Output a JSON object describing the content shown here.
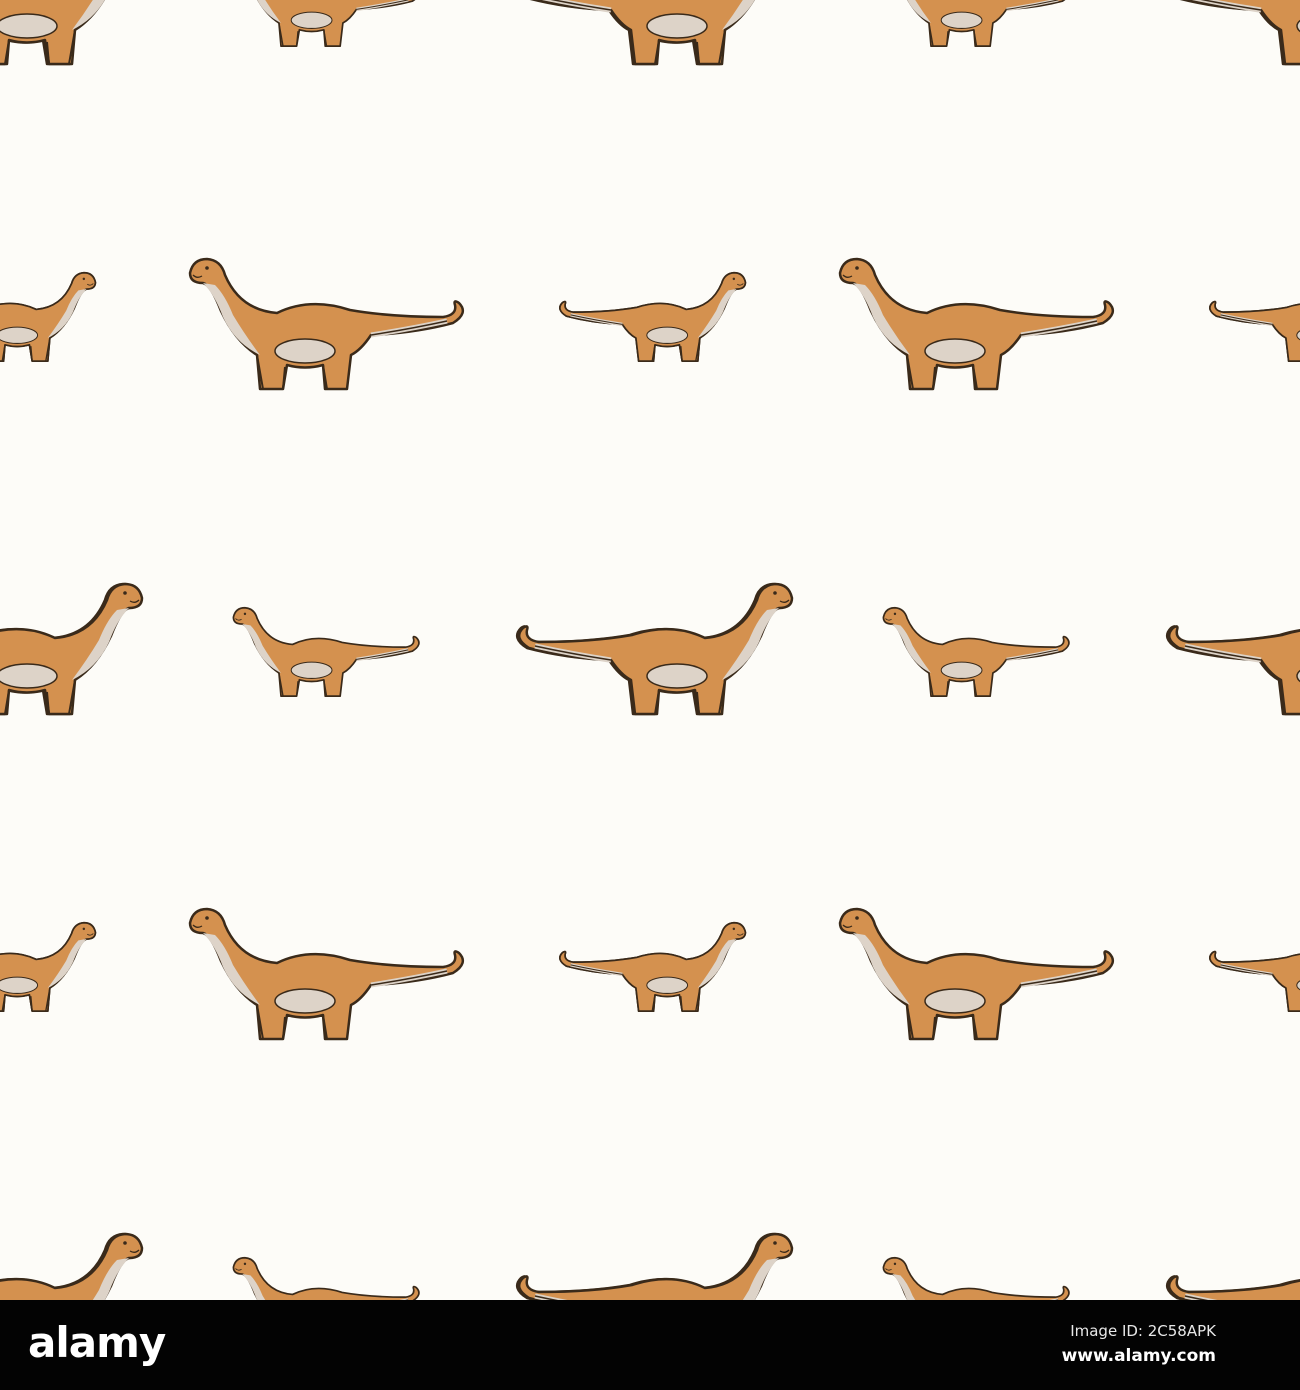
{
  "watermark": {
    "logo": "alamy",
    "image_id": "Image ID: 2C58APK",
    "url": "www.alamy.com"
  },
  "colors": {
    "background": "#fdfcf8",
    "dino_body": "#d4914f",
    "dino_belly": "#ddd3c8",
    "outline": "#3a2a1a",
    "bar": "#030303"
  }
}
